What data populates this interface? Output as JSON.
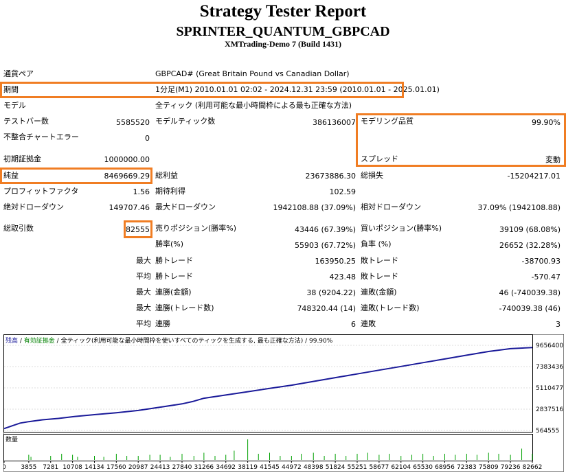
{
  "report": {
    "title": "Strategy Tester Report",
    "expert": "SPRINTER_QUANTUM_GBPCAD",
    "server": "XMTrading-Demo 7 (Build 1431)"
  },
  "info": {
    "symbol_label": "通貨ペア",
    "symbol_value": "GBPCAD# (Great Britain Pound vs Canadian Dollar)",
    "period_label": "期間",
    "period_value": "1分足(M1) 2010.01.01 02:02 - 2024.12.31 23:59 (2010.01.01 - 2025.01.01)",
    "model_label": "モデル",
    "model_value": "全ティック (利用可能な最小時間枠による最も正確な方法)"
  },
  "stats": {
    "bars_label": "テストバー数",
    "bars_value": "5585520",
    "ticks_label": "モデルティック数",
    "ticks_value": "386136007",
    "quality_label": "モデリング品質",
    "quality_value": "99.90%",
    "mismatch_label": "不整合チャートエラー",
    "mismatch_value": "0",
    "deposit_label": "初期証拠金",
    "deposit_value": "1000000.00",
    "spread_label": "スプレッド",
    "spread_value": "変動",
    "net_label": "純益",
    "net_value": "8469669.29",
    "gross_profit_label": "総利益",
    "gross_profit_value": "23673886.30",
    "gross_loss_label": "総損失",
    "gross_loss_value": "-15204217.01",
    "pf_label": "プロフィットファクタ",
    "pf_value": "1.56",
    "payoff_label": "期待利得",
    "payoff_value": "102.59",
    "abs_dd_label": "絶対ドローダウン",
    "abs_dd_value": "149707.46",
    "max_dd_label": "最大ドローダウン",
    "max_dd_value": "1942108.88 (37.09%)",
    "rel_dd_label": "相対ドローダウン",
    "rel_dd_value": "37.09% (1942108.88)",
    "trades_label": "総取引数",
    "trades_value": "82555",
    "short_label": "売りポジション(勝率%)",
    "short_value": "43446 (67.39%)",
    "long_label": "買いポジション(勝率%)",
    "long_value": "39109 (68.08%)",
    "win_label": "勝率(%)",
    "win_value": "55903 (67.72%)",
    "loss_label": "負率 (%)",
    "loss_value": "26652 (32.28%)",
    "max_prefix": "最大",
    "avg_prefix": "平均",
    "largest_win_label": "勝トレード",
    "largest_win_value": "163950.25",
    "largest_loss_label": "敗トレード",
    "largest_loss_value": "-38700.93",
    "avg_win_label": "勝トレード",
    "avg_win_value": "423.48",
    "avg_loss_label": "敗トレード",
    "avg_loss_value": "-570.47",
    "cw_label": "連勝(金額)",
    "cw_value": "38 (9204.22)",
    "cl_label": "連敗(金額)",
    "cl_value": "46 (-740039.38)",
    "cp_label": "連勝(トレード数)",
    "cp_value": "748320.44 (14)",
    "cls_label": "連敗(トレード数)",
    "cls_value": "-740039.38 (46)",
    "avg_cw_label": "連勝",
    "avg_cw_value": "6",
    "avg_cl_label": "連敗",
    "avg_cl_value": "3"
  },
  "chart_data": {
    "type": "line",
    "legend": {
      "balance": "残高",
      "sep1": " / ",
      "margin": "有効証拠金",
      "sep2": " / ",
      "rest": "全ティック(利用可能な最小時間枠を使いすべてのティックを生成する, 最も正確な方法) / 99.90%"
    },
    "volume_label": "数量",
    "y_ticks": [
      "9656400",
      "7383436",
      "5110477",
      "2837516",
      "564555"
    ],
    "x_ticks": [
      "0",
      "3855",
      "7281",
      "10708",
      "14134",
      "17560",
      "20987",
      "24413",
      "27840",
      "31266",
      "34692",
      "38119",
      "41545",
      "44972",
      "48398",
      "51824",
      "55251",
      "58677",
      "62104",
      "65530",
      "68956",
      "72383",
      "75809",
      "79236",
      "82662"
    ],
    "ylim": [
      564555,
      9656400
    ],
    "xlim": [
      0,
      82662
    ],
    "series": [
      {
        "x": [
          0,
          1200,
          2500,
          3855,
          6000,
          8500,
          11000,
          14134,
          17560,
          20987,
          24413,
          27840,
          29500,
          31266,
          34692,
          38119,
          41545,
          44972,
          48398,
          51824,
          55251,
          58677,
          62104,
          65530,
          68956,
          72383,
          75809,
          79236,
          82662
        ],
        "values": [
          760000,
          1050000,
          1350000,
          1500000,
          1700000,
          1850000,
          2050000,
          2250000,
          2450000,
          2700000,
          3050000,
          3400000,
          3650000,
          4000000,
          4350000,
          4700000,
          5050000,
          5400000,
          5800000,
          6200000,
          6600000,
          7000000,
          7400000,
          7800000,
          8200000,
          8600000,
          9000000,
          9300000,
          9420000
        ]
      }
    ],
    "volume_x": [
      3855,
      4200,
      7281,
      9000,
      10708,
      11500,
      14134,
      15600,
      17560,
      19200,
      20987,
      22800,
      24413,
      26000,
      27840,
      29700,
      31266,
      33000,
      34692,
      36000,
      38119,
      39800,
      41545,
      43200,
      44972,
      46500,
      48398,
      50100,
      51824,
      53500,
      55251,
      56900,
      58677,
      60300,
      62104,
      63800,
      65530,
      67200,
      68956,
      70600,
      72383,
      74000,
      75809,
      77400,
      79236,
      81000,
      82662
    ],
    "volume_v": [
      0.25,
      0.15,
      0.2,
      0.3,
      0.25,
      0.15,
      0.2,
      0.15,
      0.3,
      0.2,
      0.2,
      0.25,
      0.25,
      0.15,
      0.3,
      0.2,
      0.35,
      0.2,
      0.25,
      0.45,
      1.0,
      0.3,
      0.35,
      0.2,
      0.2,
      0.3,
      0.35,
      0.2,
      0.3,
      0.2,
      0.3,
      0.35,
      0.25,
      0.3,
      0.2,
      0.25,
      0.3,
      0.2,
      0.3,
      0.25,
      0.3,
      0.25,
      0.35,
      0.3,
      0.25,
      0.55,
      0.3
    ]
  }
}
